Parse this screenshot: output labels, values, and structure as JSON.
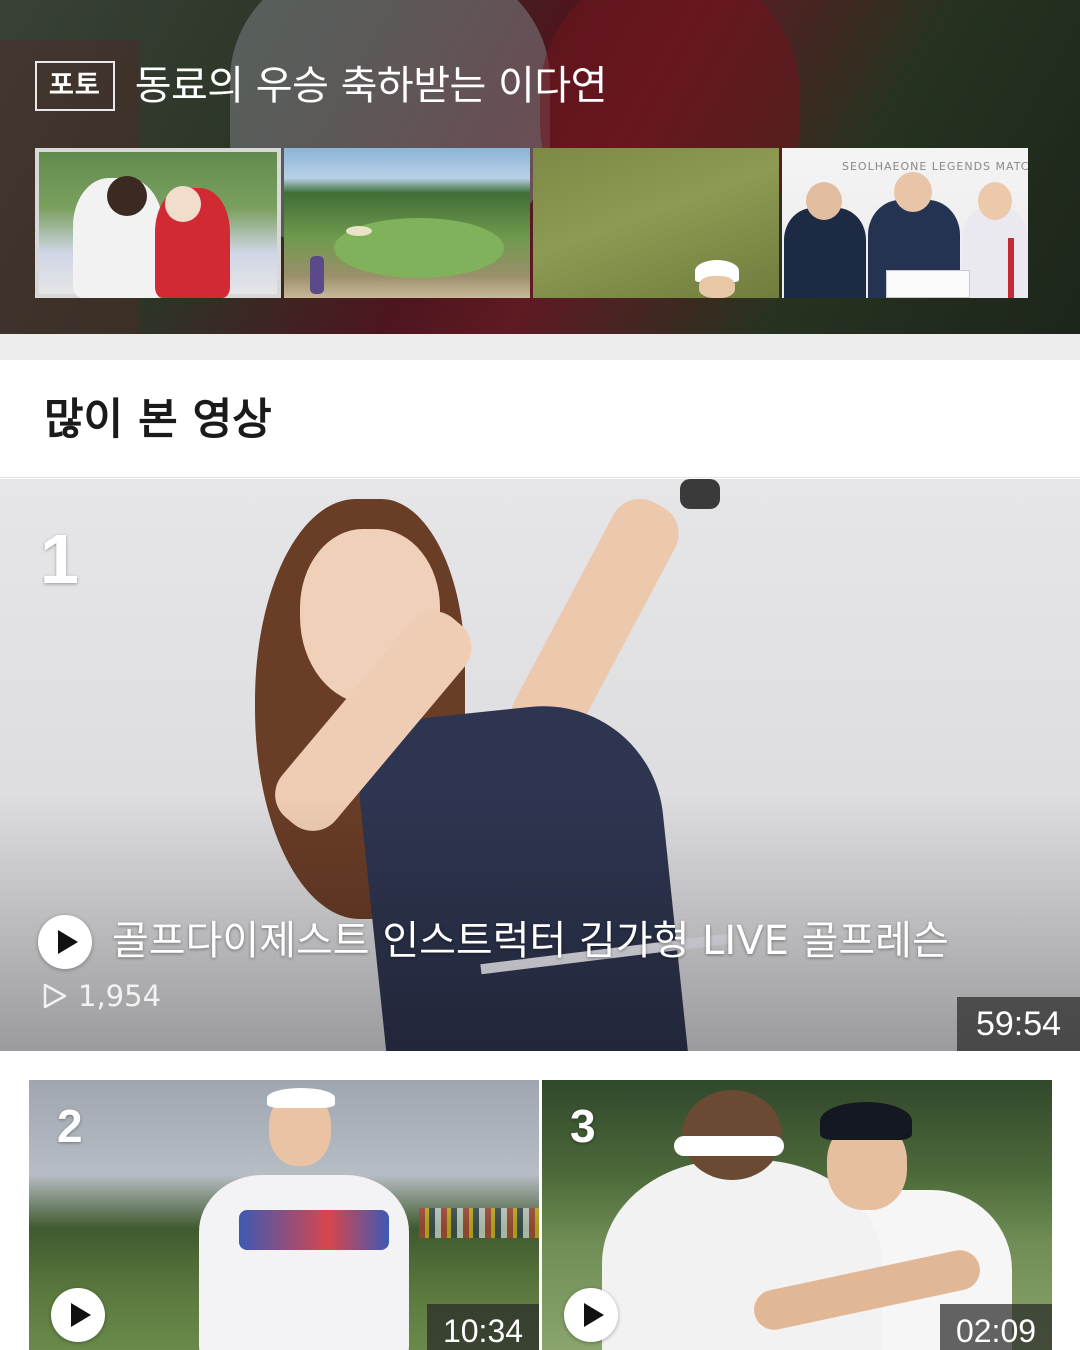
{
  "photo_section": {
    "badge": "포토",
    "title": "동료의 우승 축하받는 이다연",
    "thumbnails": [
      {
        "icon": "golfer-hug-photo",
        "selected": true
      },
      {
        "icon": "golf-course-photo",
        "selected": false
      },
      {
        "icon": "golfer-in-grass-photo",
        "selected": false
      },
      {
        "icon": "ceremony-photo",
        "selected": false,
        "caption": "SEOLHAEONE LEGENDS MATC"
      }
    ]
  },
  "popular_videos": {
    "section_title": "많이 본 영상",
    "featured": {
      "rank": "1",
      "title": "골프다이제스트 인스트럭터 김가형 LIVE 골프레슨",
      "views": "1,954",
      "duration": "59:54"
    },
    "items": [
      {
        "rank": "2",
        "duration": "10:34"
      },
      {
        "rank": "3",
        "duration": "02:09"
      }
    ]
  },
  "colors": {
    "overlay_text": "#ffffff",
    "duration_bg": "#3a3a3a",
    "section_gap": "#ededed"
  }
}
